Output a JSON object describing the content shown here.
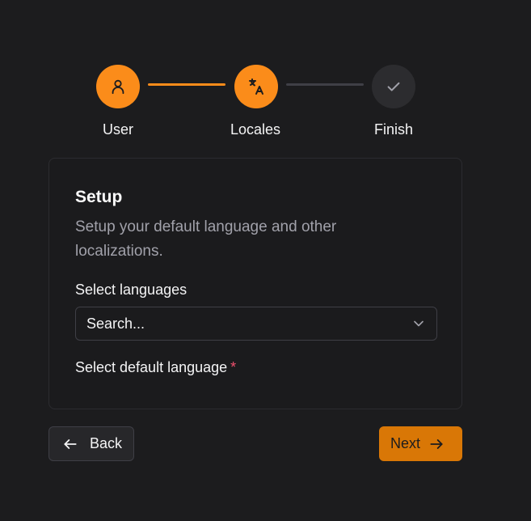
{
  "stepper": {
    "steps": [
      {
        "label": "User",
        "icon": "user-icon",
        "state": "complete"
      },
      {
        "label": "Locales",
        "icon": "translate-icon",
        "state": "active"
      },
      {
        "label": "Finish",
        "icon": "check-icon",
        "state": "pending"
      }
    ]
  },
  "card": {
    "title": "Setup",
    "description": "Setup your default language and other localizations.",
    "languages": {
      "label": "Select languages",
      "placeholder": "Search..."
    },
    "default_language": {
      "label": "Select default language",
      "required_mark": "*"
    }
  },
  "footer": {
    "back_label": "Back",
    "next_label": "Next"
  },
  "colors": {
    "accent": "#fb8c1a",
    "background": "#1c1c1e",
    "required": "#f0506e"
  }
}
